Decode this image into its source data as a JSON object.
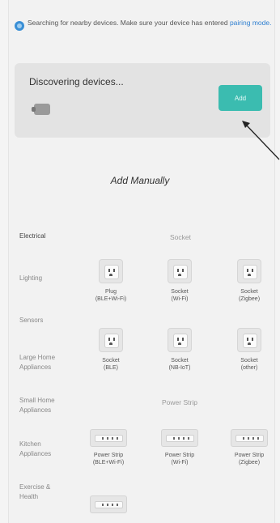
{
  "notice": {
    "text": "Searching for nearby devices. Make sure your device has entered ",
    "link": "pairing mode."
  },
  "discovery": {
    "title": "Discovering devices",
    "dots": "...",
    "add_label": "Add"
  },
  "manual": {
    "title": "Add Manually"
  },
  "categories": [
    {
      "label": "Electrical"
    },
    {
      "label": "Lighting"
    },
    {
      "label": "Sensors"
    },
    {
      "label": "Large Home Appliances"
    },
    {
      "label": "Small Home Appliances"
    },
    {
      "label": "Kitchen Appliances"
    },
    {
      "label": "Exercise & Health"
    }
  ],
  "sections": {
    "socket": "Socket",
    "power_strip": "Power Strip"
  },
  "devices": [
    {
      "name": "Plug",
      "protocol": "(BLE+Wi-Fi)"
    },
    {
      "name": "Socket",
      "protocol": "(Wi-Fi)"
    },
    {
      "name": "Socket",
      "protocol": "(Zigbee)"
    },
    {
      "name": "Socket",
      "protocol": "(BLE)"
    },
    {
      "name": "Socket",
      "protocol": "(NB-IoT)"
    },
    {
      "name": "Socket",
      "protocol": "(other)"
    }
  ],
  "strips": [
    {
      "name": "Power Strip",
      "protocol": "(BLE+Wi-Fi)"
    },
    {
      "name": "Power Strip",
      "protocol": "(Wi-Fi)"
    },
    {
      "name": "Power Strip",
      "protocol": "(Zigbee)"
    }
  ],
  "colors": {
    "accent": "#3bbcb0",
    "link": "#2f7fd0"
  }
}
